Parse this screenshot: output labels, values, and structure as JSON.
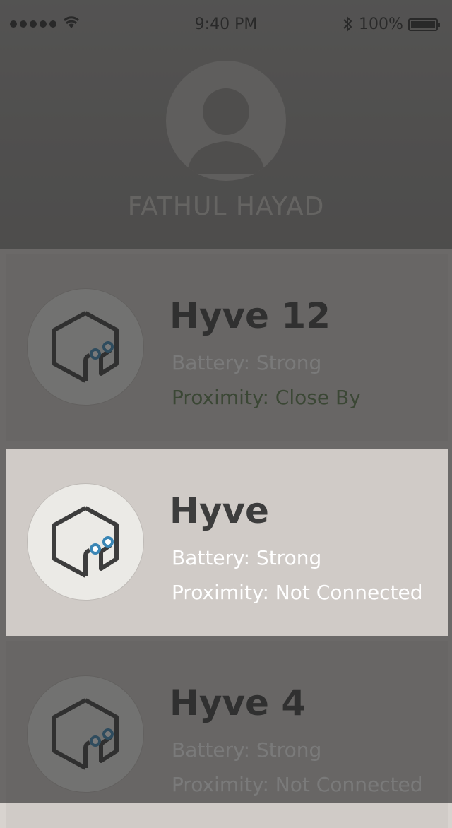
{
  "status_bar": {
    "time": "9:40 PM",
    "battery_percent": "100%",
    "signal_dots": 5
  },
  "profile": {
    "name": "FATHUL HAYAD"
  },
  "devices": [
    {
      "name": "Hyve 12",
      "battery": "Battery: Strong",
      "proximity": "Proximity: Close By"
    },
    {
      "name": "Hyve",
      "battery": "Battery: Strong",
      "proximity": "Proximity: Not Connected"
    },
    {
      "name": "Hyve 4",
      "battery": "Battery: Strong",
      "proximity": "Proximity: Not Connected"
    }
  ],
  "colors": {
    "overlay": "#282828",
    "card": "#d0cbc7",
    "logo_bg": "#ebeae6",
    "accent_eye": "#3a86b5",
    "proximity_green": "#5a7a4a"
  }
}
